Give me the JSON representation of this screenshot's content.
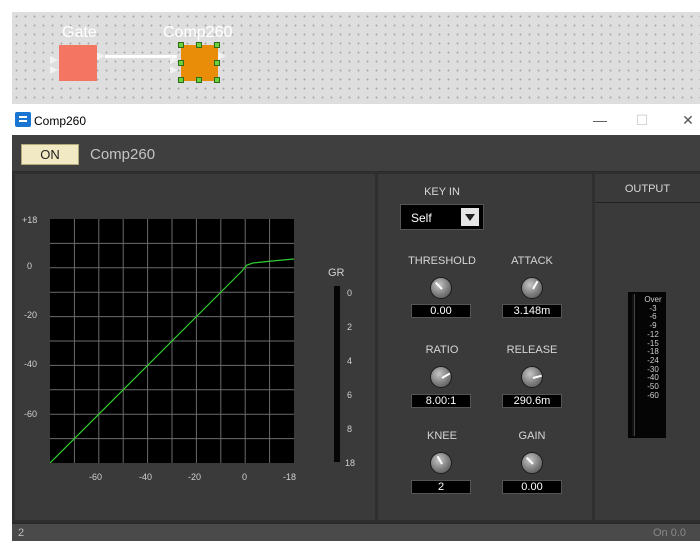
{
  "designer": {
    "components": [
      {
        "name": "Gate",
        "color": "#f47562"
      },
      {
        "name": "Comp260",
        "color": "#e98d08"
      }
    ]
  },
  "window": {
    "title": "Comp260",
    "controls": {
      "minimize": "—",
      "maximize": "☐",
      "close": "✕"
    }
  },
  "header": {
    "on_label": "ON",
    "component_name": "Comp260"
  },
  "graph": {
    "y_ticks": [
      "+18",
      "0",
      "-20",
      "-40",
      "-60"
    ],
    "x_ticks": [
      "-60",
      "-40",
      "-20",
      "0",
      "-18"
    ],
    "gr_title": "GR",
    "gr_ticks": [
      "0",
      "2",
      "4",
      "6",
      "8",
      "18"
    ]
  },
  "dynamics": {
    "key_in_label": "KEY IN",
    "key_in_value": "Self",
    "threshold": {
      "label": "THRESHOLD",
      "value": "0.00"
    },
    "attack": {
      "label": "ATTACK",
      "value": "3.148m"
    },
    "ratio": {
      "label": "RATIO",
      "value": "8.00:1"
    },
    "release": {
      "label": "RELEASE",
      "value": "290.6m"
    },
    "knee": {
      "label": "KNEE",
      "value": "2"
    },
    "gain": {
      "label": "GAIN",
      "value": "0.00"
    }
  },
  "output": {
    "title": "OUTPUT",
    "scale": [
      "Over",
      "-3",
      "-6",
      "-9",
      "-12",
      "-15",
      "-18",
      "-24",
      "-30",
      "-40",
      "-50",
      "-60"
    ]
  },
  "status": {
    "left": "2",
    "right": "On 0.0"
  }
}
